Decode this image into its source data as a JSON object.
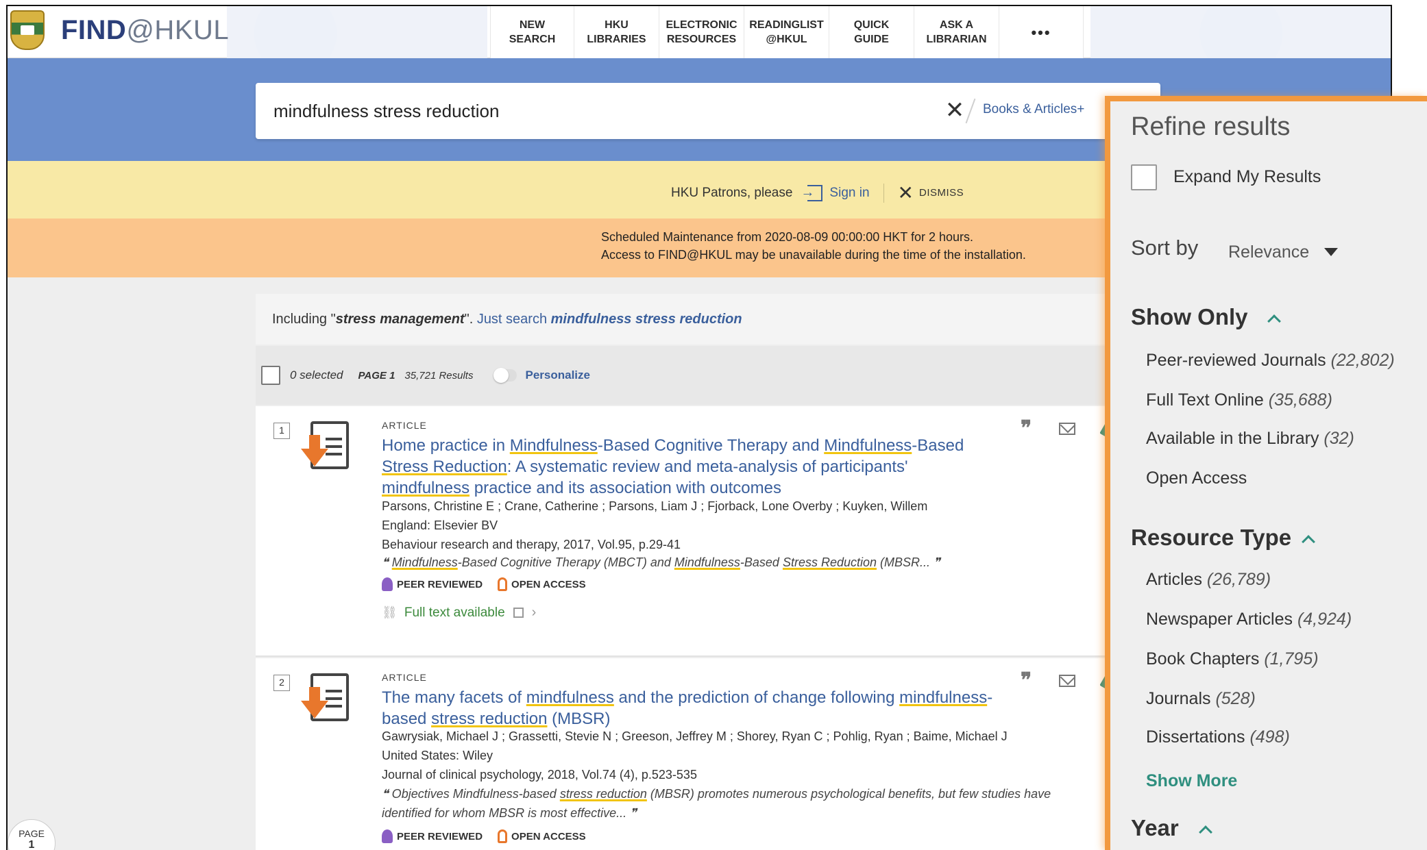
{
  "brand": {
    "find": "FIND",
    "at": "@HKUL"
  },
  "nav": [
    {
      "label": "NEW\nSEARCH"
    },
    {
      "label": "HKU\nLIBRARIES"
    },
    {
      "label": "ELECTRONIC\nRESOURCES"
    },
    {
      "label": "READINGLIST\n@HKUL"
    },
    {
      "label": "QUICK\nGUIDE"
    },
    {
      "label": "ASK A\nLIBRARIAN"
    },
    {
      "label": "•••"
    }
  ],
  "search": {
    "query": "mindfulness stress reduction",
    "clear": "✕",
    "scope": "Books & Articles+"
  },
  "signin_banner": {
    "prompt": "HKU Patrons, please",
    "signin": "Sign in",
    "dismiss_x": "✕",
    "dismiss": "DISMISS"
  },
  "maintenance": {
    "line1": "Scheduled Maintenance from 2020-08-09 00:00:00 HKT for 2 hours.",
    "line2": "Access to FIND@HKUL may be unavailable during the time of the installation."
  },
  "including": {
    "prefix": "Including \"",
    "term": "stress management",
    "suffix": "\". ",
    "link_prefix": "Just search ",
    "link_query": "mindfulness stress reduction"
  },
  "toolbar": {
    "selected": "0 selected",
    "page": "PAGE 1",
    "results": "35,721 Results",
    "personalize": "Personalize"
  },
  "results": [
    {
      "num": "1",
      "type": "ARTICLE",
      "title_parts": [
        "Home practice in ",
        "Mindfulness",
        "-Based Cognitive Therapy and ",
        "Mindfulness",
        "-Based ",
        "Stress Reduction",
        ": A systematic review and meta-analysis of participants' ",
        "mindfulness",
        " practice and its association with outcomes"
      ],
      "authors": "Parsons, Christine E ; Crane, Catherine ; Parsons, Liam J ; Fjorback, Lone Overby ; Kuyken, Willem",
      "publisher": "England: Elsevier BV",
      "source": "Behaviour research and therapy, 2017, Vol.95, p.29-41",
      "snippet_parts": [
        "❝ ",
        "Mindfulness",
        "-Based Cognitive Therapy (MBCT) and ",
        "Mindfulness",
        "-Based ",
        "Stress Reduction",
        " (MBSR... ❞"
      ],
      "peer": "PEER REVIEWED",
      "open": "OPEN ACCESS",
      "fulltext": "Full text available"
    },
    {
      "num": "2",
      "type": "ARTICLE",
      "title_parts": [
        "The many facets of ",
        "mindfulness",
        " and the prediction of change following ",
        "mindfulness",
        "-based ",
        "stress reduction",
        " (MBSR)"
      ],
      "authors": "Gawrysiak, Michael J ; Grassetti, Stevie N ; Greeson, Jeffrey M ; Shorey, Ryan C ; Pohlig, Ryan ; Baime, Michael J",
      "publisher": "United States: Wiley",
      "source": "Journal of clinical psychology, 2018, Vol.74 (4), p.523-535",
      "snippet_parts": [
        "❝ Objectives Mindfulness-based ",
        "stress reduction",
        " (MBSR) promotes numerous psychological benefits, but few studies have identified for whom MBSR is most effective... ❞"
      ],
      "peer": "PEER REVIEWED",
      "open": "OPEN ACCESS"
    }
  ],
  "page_indicator": {
    "label": "PAGE",
    "number": "1"
  },
  "refine": {
    "heading": "Refine results",
    "expand": "Expand My Results",
    "sort_label": "Sort by",
    "sort_value": "Relevance",
    "show_only_title": "Show Only",
    "show_only": [
      {
        "label": "Peer-reviewed Journals",
        "count": "(22,802)"
      },
      {
        "label": "Full Text Online",
        "count": "(35,688)"
      },
      {
        "label": "Available in the Library",
        "count": "(32)"
      },
      {
        "label": "Open Access",
        "count": ""
      }
    ],
    "resource_title": "Resource Type",
    "resource": [
      {
        "label": "Articles",
        "count": "(26,789)"
      },
      {
        "label": "Newspaper Articles",
        "count": "(4,924)"
      },
      {
        "label": "Book Chapters",
        "count": "(1,795)"
      },
      {
        "label": "Journals",
        "count": "(528)"
      },
      {
        "label": "Dissertations",
        "count": "(498)"
      }
    ],
    "show_more": "Show More",
    "year_title": "Year"
  },
  "colors": {
    "brand_blue": "#3a5f9c",
    "search_band": "#6a8ecd",
    "signin_banner": "#f8e9a6",
    "maintenance_banner": "#fbc58c",
    "refine_border": "#f2993f",
    "teal_accent": "#2f8f7f"
  }
}
